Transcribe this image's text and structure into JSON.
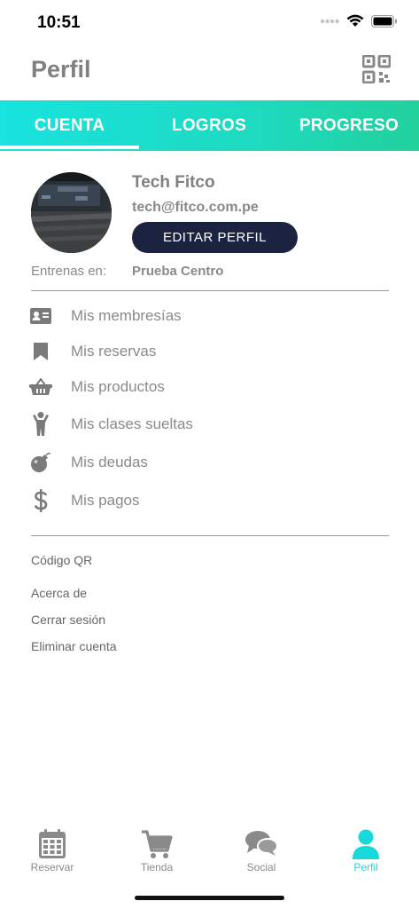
{
  "status_bar": {
    "time": "10:51"
  },
  "header": {
    "title": "Perfil",
    "qr_icon": "qr-code-icon"
  },
  "tabs": [
    {
      "label": "CUENTA",
      "active": true
    },
    {
      "label": "LOGROS",
      "active": false
    },
    {
      "label": "PROGRESO",
      "active": false
    }
  ],
  "profile": {
    "name": "Tech Fitco",
    "email": "tech@fitco.com.pe",
    "edit_button": "EDITAR PERFIL",
    "train_label": "Entrenas en:",
    "train_value": "Prueba Centro"
  },
  "menu": [
    {
      "label": "Mis membresías",
      "icon": "id-card-icon"
    },
    {
      "label": "Mis reservas",
      "icon": "bookmark-icon"
    },
    {
      "label": "Mis productos",
      "icon": "basket-icon"
    },
    {
      "label": "Mis clases sueltas",
      "icon": "person-icon"
    },
    {
      "label": "Mis deudas",
      "icon": "bomb-icon"
    },
    {
      "label": "Mis pagos",
      "icon": "dollar-icon"
    }
  ],
  "links": {
    "qr": "Código QR",
    "about": "Acerca de",
    "logout": "Cerrar sesión",
    "delete": "Eliminar cuenta"
  },
  "bottom_nav": [
    {
      "label": "Reservar",
      "icon": "calendar-icon",
      "active": false
    },
    {
      "label": "Tienda",
      "icon": "cart-icon",
      "active": false
    },
    {
      "label": "Social",
      "icon": "chat-icon",
      "active": false
    },
    {
      "label": "Perfil",
      "icon": "user-icon",
      "active": true
    }
  ],
  "colors": {
    "accent": "#18d9d9",
    "button": "#1c2340",
    "text": "#8a8a8a"
  }
}
